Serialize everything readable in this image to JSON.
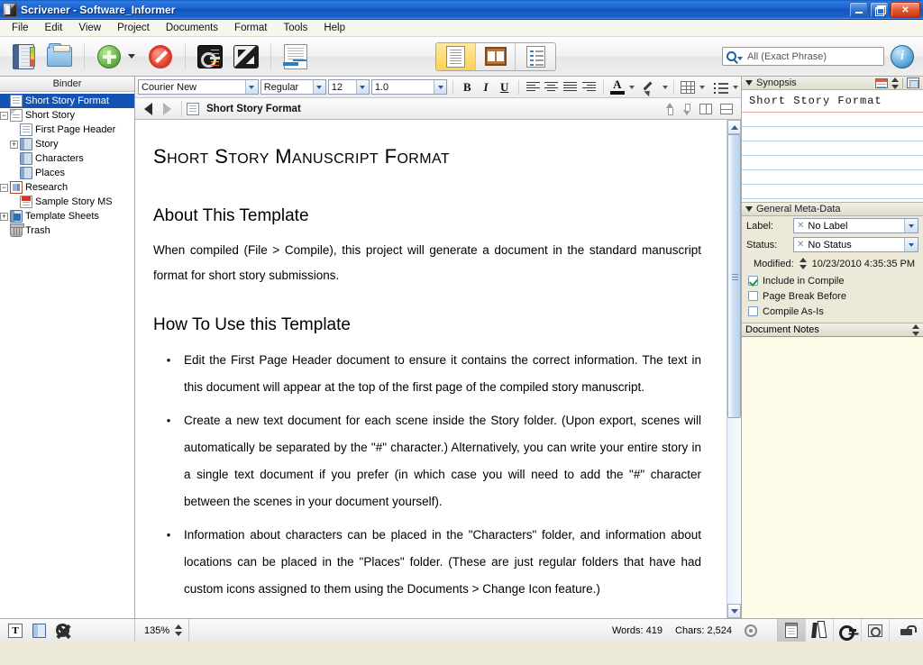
{
  "window": {
    "title": "Scrivener - Software_Informer",
    "app_icon": "scrivener-icon",
    "minimize": "minimize",
    "restore": "restore",
    "close": "close"
  },
  "menubar": {
    "items": [
      "File",
      "Edit",
      "View",
      "Project",
      "Documents",
      "Format",
      "Tools",
      "Help"
    ]
  },
  "toolbar": {
    "buttons": [
      {
        "name": "binder-toggle",
        "icon": "binder-icon"
      },
      {
        "name": "collections",
        "icon": "folder-icon"
      },
      {
        "name": "add",
        "icon": "green-plus-icon"
      },
      {
        "name": "add-dropdown",
        "icon": "caret-down-icon"
      },
      {
        "name": "no-entry",
        "icon": "no-entry-icon"
      },
      {
        "name": "keywords",
        "icon": "keywords-panel-icon"
      },
      {
        "name": "full-screen",
        "icon": "full-screen-icon"
      },
      {
        "name": "export",
        "icon": "export-document-icon"
      }
    ],
    "view_modes": [
      {
        "name": "document-view",
        "icon": "document-view-icon",
        "selected": true
      },
      {
        "name": "corkboard-view",
        "icon": "corkboard-icon",
        "selected": false
      },
      {
        "name": "outliner-view",
        "icon": "outliner-icon",
        "selected": false
      }
    ],
    "search": {
      "icon": "magnifier-icon",
      "value": "All (Exact Phrase)",
      "placeholder": "All (Exact Phrase)"
    },
    "info_button": {
      "label": "i",
      "name": "inspector-toggle"
    }
  },
  "binder": {
    "header": "Binder",
    "items": [
      {
        "label": "Short Story Format",
        "depth": 0,
        "icon": "document-icon",
        "twisty": "none",
        "selected": true
      },
      {
        "label": "Short Story",
        "depth": 0,
        "icon": "draft-folder-icon",
        "twisty": "minus",
        "selected": false
      },
      {
        "label": "First Page Header",
        "depth": 1,
        "icon": "document-icon",
        "twisty": "none",
        "selected": false
      },
      {
        "label": "Story",
        "depth": 1,
        "icon": "folder-icon",
        "twisty": "plus",
        "selected": false
      },
      {
        "label": "Characters",
        "depth": 1,
        "icon": "folder-icon",
        "twisty": "none",
        "selected": false
      },
      {
        "label": "Places",
        "depth": 1,
        "icon": "folder-icon",
        "twisty": "none",
        "selected": false
      },
      {
        "label": "Research",
        "depth": 0,
        "icon": "research-folder-icon",
        "twisty": "minus",
        "selected": false
      },
      {
        "label": "Sample Story MS",
        "depth": 1,
        "icon": "pdf-icon",
        "twisty": "none",
        "selected": false
      },
      {
        "label": "Template Sheets",
        "depth": 0,
        "icon": "template-folder-icon",
        "twisty": "plus",
        "selected": false
      },
      {
        "label": "Trash",
        "depth": 0,
        "icon": "trash-icon",
        "twisty": "none",
        "selected": false
      }
    ]
  },
  "format_bar": {
    "font_family": "Courier New",
    "font_style": "Regular",
    "font_size": "12",
    "line_spacing": "1.0",
    "bold": "B",
    "italic": "I",
    "underline": "U",
    "align_left": "align-left",
    "align_center": "align-center",
    "align_justify": "align-justify",
    "align_right": "align-right",
    "text_color": "A",
    "highlight": "highlighter-icon",
    "table": "table-icon",
    "lists": "list-icon"
  },
  "doc_header": {
    "back": "back-arrow",
    "forward": "forward-arrow",
    "icon": "document-icon",
    "title": "Short Story Format",
    "go_up": "go-up-arrow",
    "go_down": "go-down-arrow",
    "split_vertical": "split-vertical-icon",
    "split_horizontal": "split-horizontal-icon"
  },
  "document": {
    "title_parts": [
      {
        "big": "S",
        "rest": "HORT"
      },
      {
        "big": "S",
        "rest": "TORY"
      },
      {
        "big": "M",
        "rest": "ANUSCRIPT"
      },
      {
        "big": "F",
        "rest": "ORMAT"
      }
    ],
    "title_plain": "Short Story Manuscript Format",
    "sections": [
      {
        "heading": "About This Template",
        "paragraph": "When compiled (File > Compile), this project will generate a document in the standard manuscript format for short story submissions."
      },
      {
        "heading": "How To Use this Template",
        "bullets": [
          "Edit the First Page Header document to ensure it contains the correct information. The text in this document will appear at the top of the first page of the compiled story manuscript.",
          "Create a new text document for each scene inside the Story folder. (Upon export, scenes will automatically be separated by the \"#\" character.) Alternatively, you can write your entire story in a single text document if you prefer (in which case you will need to add the \"#\" character between the scenes in your document yourself).",
          "Information about characters can be placed in the \"Characters\" folder, and information about locations can be placed in the \"Places\" folder. (These are just regular folders that have had custom icons assigned to them using the Documents > Change Icon feature.)"
        ]
      }
    ],
    "bullet_char": "•"
  },
  "inspector": {
    "synopsis": {
      "title": "Synopsis",
      "text": "Short Story Format",
      "card_icon": "index-card-icon",
      "spinner_icon": "up-down-arrows-icon",
      "image_icon": "image-card-icon"
    },
    "metadata": {
      "title": "General Meta-Data",
      "label_caption": "Label:",
      "label_value": "No Label",
      "status_caption": "Status:",
      "status_value": "No Status",
      "modified_caption": "Modified:",
      "modified_value": "10/23/2010 4:35:35 PM",
      "checkboxes": [
        {
          "label": "Include in Compile",
          "checked": true
        },
        {
          "label": "Page Break Before",
          "checked": false
        },
        {
          "label": "Compile As-Is",
          "checked": false
        }
      ]
    },
    "notes": {
      "title": "Document Notes",
      "body": ""
    }
  },
  "statusbar": {
    "left_buttons": [
      {
        "name": "text-settings",
        "icon": "text-T-icon"
      },
      {
        "name": "binder-affects",
        "icon": "blue-book-icon"
      },
      {
        "name": "project-settings",
        "icon": "gear-icon"
      }
    ],
    "zoom": "135%",
    "words": "Words: 419",
    "chars": "Chars: 2,524",
    "target_icon": "target-icon",
    "right_buttons": [
      {
        "name": "notes-panel",
        "icon": "notepad-icon",
        "active": true
      },
      {
        "name": "references-panel",
        "icon": "reference-books-icon",
        "active": false
      },
      {
        "name": "keywords-panel",
        "icon": "key-icon",
        "active": false
      },
      {
        "name": "snapshots-panel",
        "icon": "photo-icon",
        "active": false
      }
    ],
    "lock_icon": "lock-icon"
  },
  "colors": {
    "title_bar": "#1b62d0",
    "selection": "#1453b4",
    "notes_bg": "#fdfbe8",
    "accent_yellow": "#fcd352",
    "panel_bg": "#ece9d8"
  }
}
